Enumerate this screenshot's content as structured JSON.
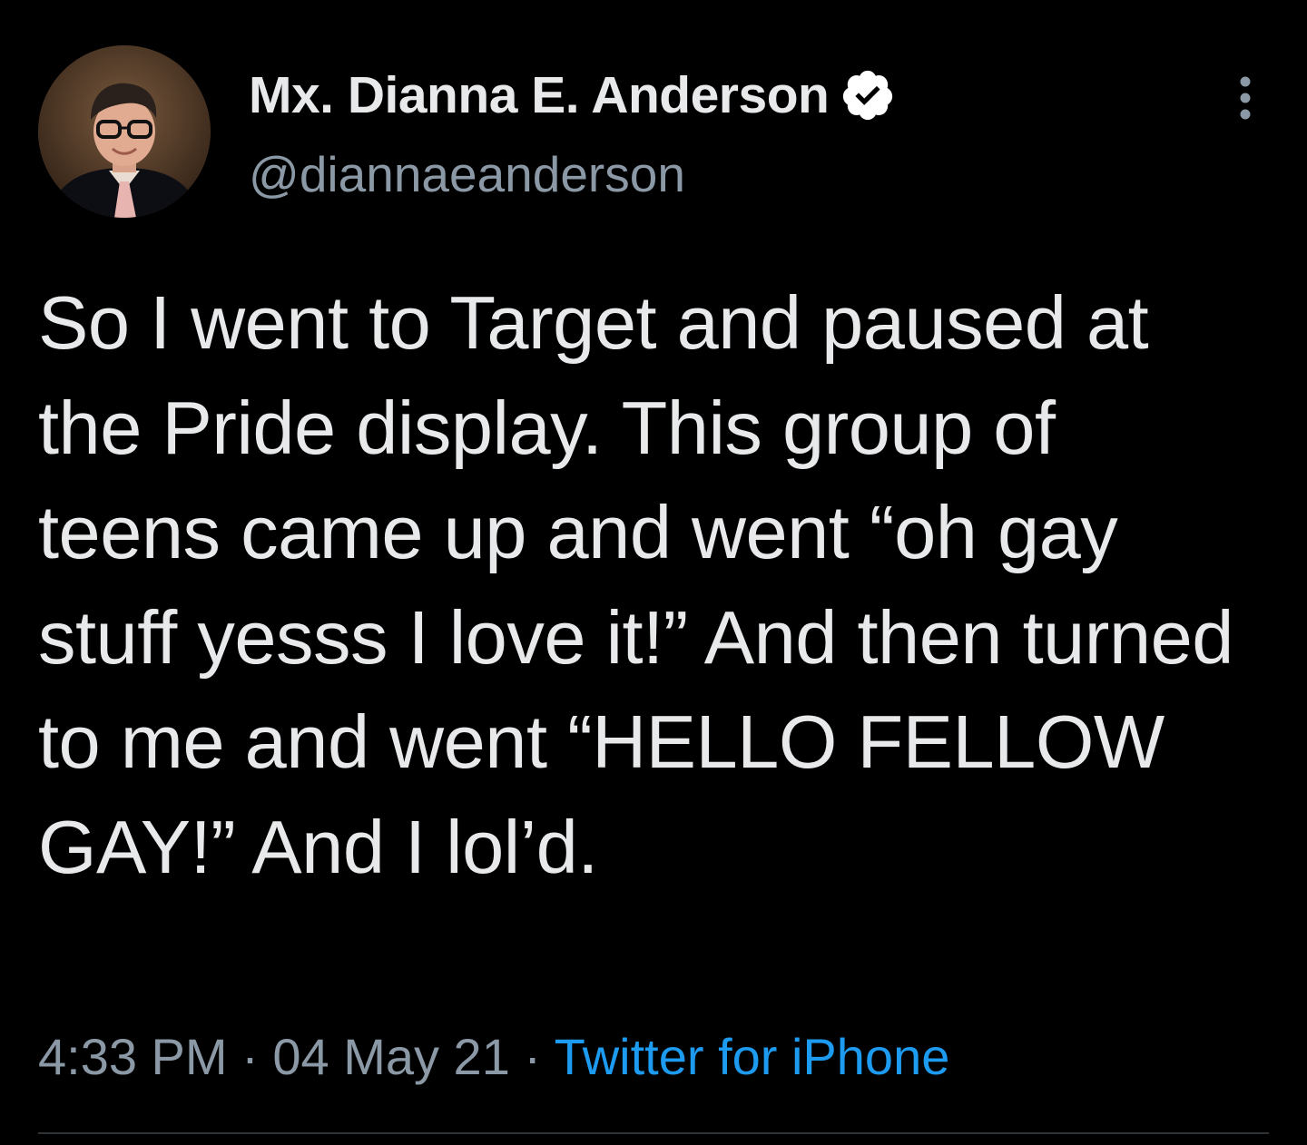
{
  "author": {
    "display_name": "Mx. Dianna E. Anderson",
    "handle": "@diannaeanderson",
    "verified": true,
    "avatar_icon": "profile-photo"
  },
  "tweet": {
    "text": "So I went to Target and paused at the Pride display. This group of teens came up and went “oh gay stuff yesss I love it!” And then turned to me and went “HELLO FELLOW GAY!” And I lol’d.",
    "time": "4:33 PM",
    "separator": "·",
    "date": "04 May 21",
    "source": "Twitter for iPhone"
  },
  "colors": {
    "background": "#000000",
    "primary_text": "#e7e9ea",
    "secondary_text": "#8b98a5",
    "link": "#1d9bf0",
    "verified_badge": "#ffffff",
    "divider": "#2f3336"
  },
  "icons": {
    "verified": "verified-badge-icon",
    "more": "more-vertical-icon"
  }
}
